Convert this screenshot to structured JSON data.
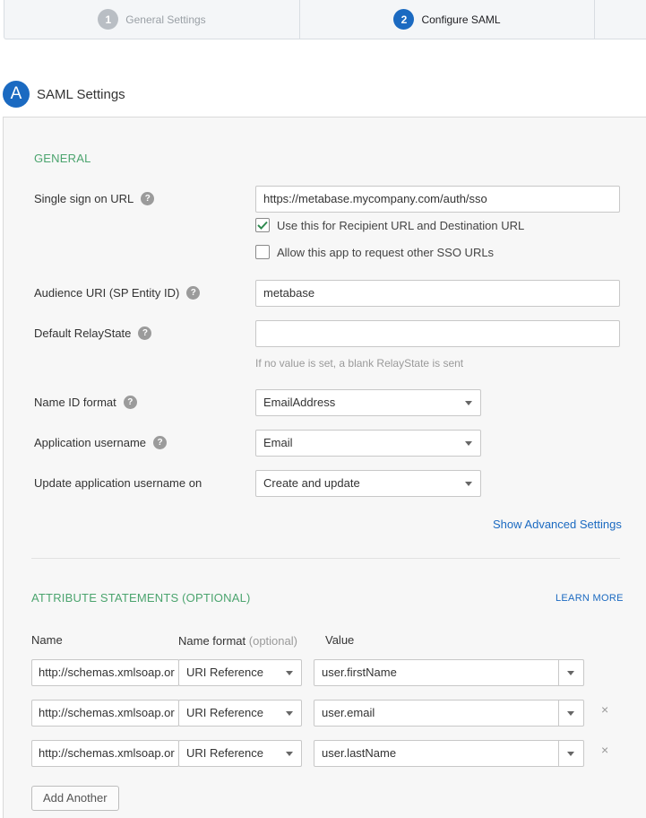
{
  "stepper": {
    "steps": [
      {
        "number": "1",
        "label": "General Settings"
      },
      {
        "number": "2",
        "label": "Configure SAML"
      }
    ]
  },
  "section": {
    "badge": "A",
    "title": "SAML Settings"
  },
  "general": {
    "title": "GENERAL",
    "sso_url": {
      "label": "Single sign on URL",
      "value": "https://metabase.mycompany.com/auth/sso"
    },
    "recipient_checkbox": {
      "label": "Use this for Recipient URL and Destination URL",
      "checked": true
    },
    "other_sso_checkbox": {
      "label": "Allow this app to request other SSO URLs",
      "checked": false
    },
    "audience_uri": {
      "label": "Audience URI (SP Entity ID)",
      "value": "metabase"
    },
    "relay_state": {
      "label": "Default RelayState",
      "value": "",
      "hint": "If no value is set, a blank RelayState is sent"
    },
    "name_id_format": {
      "label": "Name ID format",
      "value": "EmailAddress"
    },
    "app_username": {
      "label": "Application username",
      "value": "Email"
    },
    "update_username": {
      "label": "Update application username on",
      "value": "Create and update"
    },
    "advanced_link": "Show Advanced Settings",
    "help_glyph": "?"
  },
  "attributes": {
    "title": "ATTRIBUTE STATEMENTS (OPTIONAL)",
    "learn_more": "LEARN MORE",
    "columns": {
      "name": "Name",
      "format": "Name format",
      "format_optional": "(optional)",
      "value": "Value"
    },
    "rows": [
      {
        "name": "http://schemas.xmlsoap.or",
        "format": "URI Reference",
        "value": "user.firstName",
        "removable": false
      },
      {
        "name": "http://schemas.xmlsoap.or",
        "format": "URI Reference",
        "value": "user.email",
        "removable": true
      },
      {
        "name": "http://schemas.xmlsoap.or",
        "format": "URI Reference",
        "value": "user.lastName",
        "removable": true
      }
    ],
    "remove_glyph": "×",
    "add_button": "Add Another"
  }
}
